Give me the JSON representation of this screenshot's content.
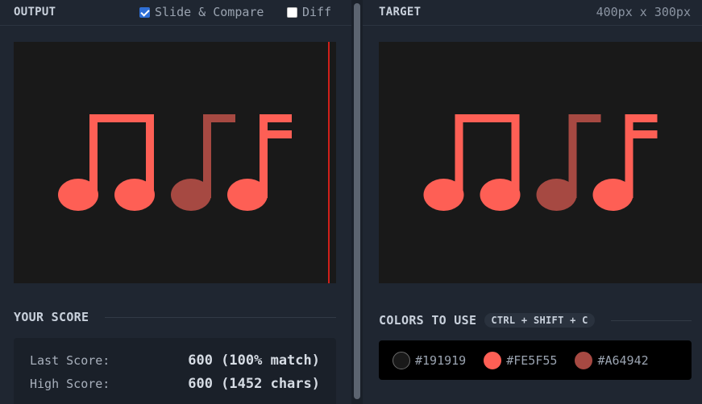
{
  "output_panel": {
    "title": "OUTPUT",
    "slide_compare_label": "Slide & Compare",
    "slide_compare_checked": true,
    "diff_label": "Diff",
    "diff_checked": false
  },
  "target_panel": {
    "title": "TARGET",
    "dimensions": "400px x 300px"
  },
  "score": {
    "heading": "YOUR SCORE",
    "last_label": "Last Score:",
    "last_value": "600 (100% match)",
    "high_label": "High Score:",
    "high_value": "600 (1452 chars)"
  },
  "colors_section": {
    "heading": "COLORS TO USE",
    "shortcut": "CTRL + SHIFT + C",
    "colors": [
      {
        "hex": "#191919",
        "label": "#191919"
      },
      {
        "hex": "#FE5F55",
        "label": "#FE5F55"
      },
      {
        "hex": "#A64942",
        "label": "#A64942"
      }
    ]
  },
  "icons": {
    "canvas_art": "music-notes-icon",
    "checkbox_checked": "checkbox-checked-icon",
    "checkbox_unchecked": "checkbox-unchecked-icon"
  }
}
